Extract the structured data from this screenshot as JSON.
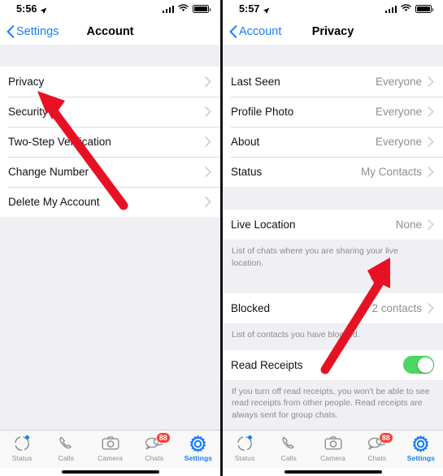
{
  "left_screen": {
    "statusbar": {
      "time": "5:56",
      "location_icon": "location-arrow-icon",
      "signal_icon": "cellular-signal-icon",
      "wifi_icon": "wifi-icon",
      "battery_icon": "battery-full-icon"
    },
    "navbar": {
      "back_label": "Settings",
      "title": "Account"
    },
    "rows": [
      {
        "label": "Privacy"
      },
      {
        "label": "Security"
      },
      {
        "label": "Two-Step Verification"
      },
      {
        "label": "Change Number"
      },
      {
        "label": "Delete My Account"
      }
    ]
  },
  "right_screen": {
    "statusbar": {
      "time": "5:57",
      "location_icon": "location-arrow-icon",
      "signal_icon": "cellular-signal-icon",
      "wifi_icon": "wifi-icon",
      "battery_icon": "battery-full-icon"
    },
    "navbar": {
      "back_label": "Account",
      "title": "Privacy"
    },
    "group_one": [
      {
        "label": "Last Seen",
        "value": "Everyone"
      },
      {
        "label": "Profile Photo",
        "value": "Everyone"
      },
      {
        "label": "About",
        "value": "Everyone"
      },
      {
        "label": "Status",
        "value": "My Contacts"
      }
    ],
    "live_location": {
      "label": "Live Location",
      "value": "None"
    },
    "live_location_footnote": "List of chats where you are sharing your live location.",
    "blocked": {
      "label": "Blocked",
      "value": "2 contacts"
    },
    "blocked_footnote": "List of contacts you have blocked.",
    "read_receipts": {
      "label": "Read Receipts",
      "state": "on"
    },
    "read_receipts_footnote": "If you turn off read receipts, you won't be able to see read receipts from other people. Read receipts are always sent for group chats."
  },
  "tabbar": {
    "items": [
      {
        "label": "Status",
        "icon": "status-ring-icon",
        "active": false,
        "dot": true
      },
      {
        "label": "Calls",
        "icon": "phone-handset-icon",
        "active": false,
        "dot": false
      },
      {
        "label": "Camera",
        "icon": "camera-icon",
        "active": false,
        "dot": false
      },
      {
        "label": "Chats",
        "icon": "chat-bubbles-icon",
        "active": false,
        "badge": "88"
      },
      {
        "label": "Settings",
        "icon": "gear-icon",
        "active": true,
        "dot": false
      }
    ]
  },
  "annotations": {
    "left_arrow": {
      "name": "red-arrow-pointing-to-privacy",
      "color": "#e81123"
    },
    "right_arrow": {
      "name": "red-arrow-pointing-to-blocked",
      "color": "#e81123"
    }
  },
  "colors": {
    "accent_blue": "#1a7dfa",
    "toggle_green": "#4cd763",
    "badge_red": "#fb3b30",
    "group_bg": "#efeff4",
    "secondary_text": "#8e8e93",
    "arrow_red": "#e81123"
  }
}
